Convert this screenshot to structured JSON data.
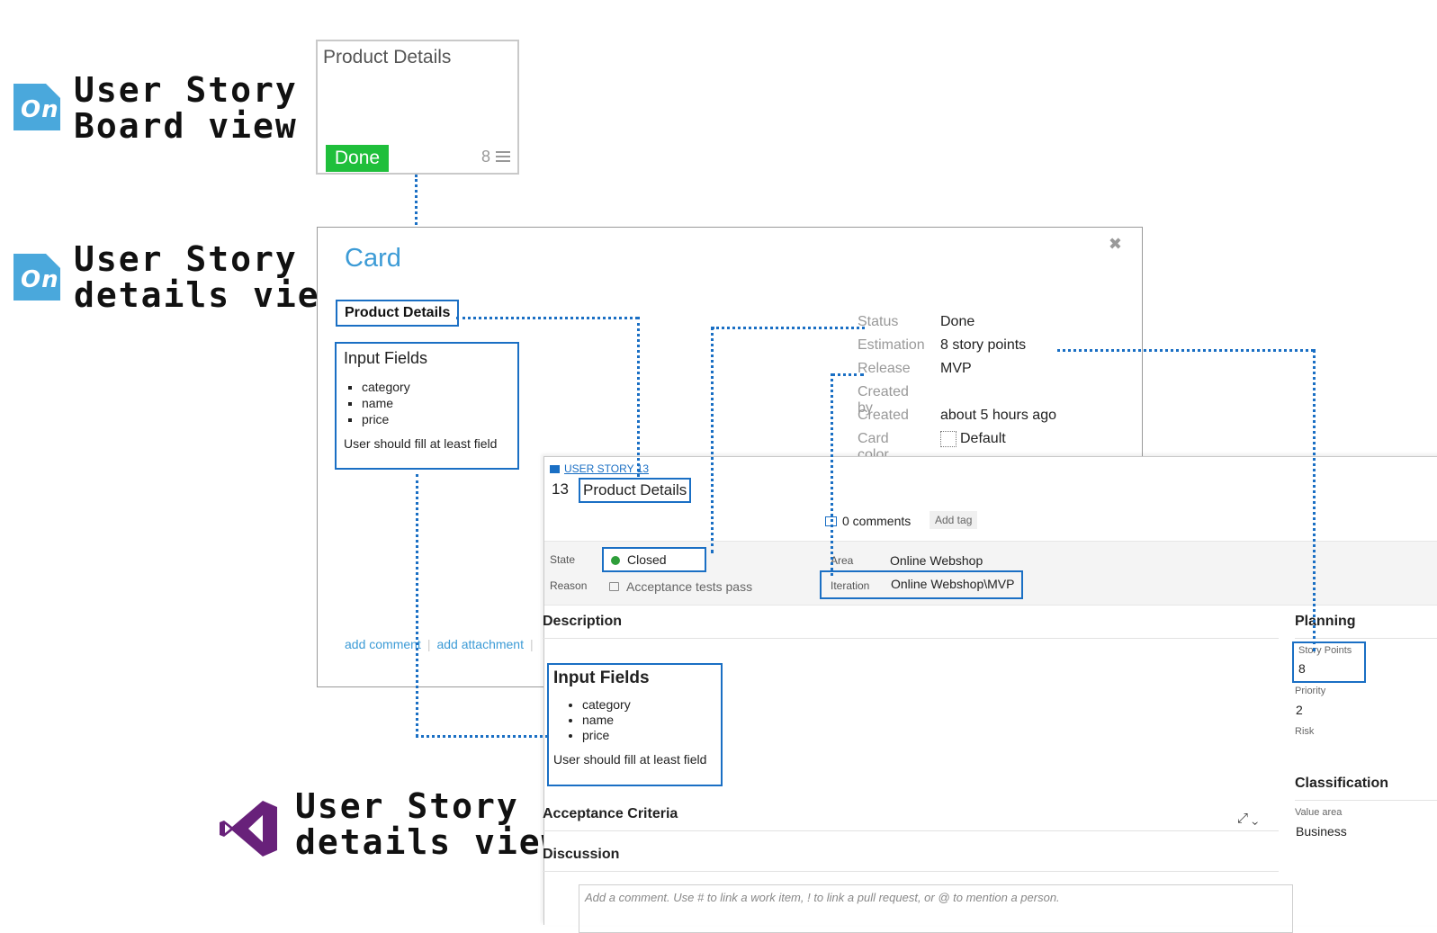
{
  "labels": {
    "board_view": [
      "User Story",
      "Board view"
    ],
    "tp_details_view": [
      "User Story",
      "details view"
    ],
    "vs_details_view": [
      "User Story",
      "details view"
    ],
    "on_logo_text": "On"
  },
  "board_card": {
    "title": "Product Details",
    "status": "Done",
    "points": "8"
  },
  "tp_card": {
    "heading": "Card",
    "name": "Product Details",
    "description": {
      "title": "Input Fields",
      "items": [
        "category",
        "name",
        "price"
      ],
      "footer": "User should fill at least field"
    },
    "properties": [
      {
        "key": "Status",
        "value": "Done"
      },
      {
        "key": "Estimation",
        "value": "8 story points"
      },
      {
        "key": "Release",
        "value": "MVP"
      },
      {
        "key": "Created by",
        "value": ""
      },
      {
        "key": "Created",
        "value": "about 5 hours ago"
      },
      {
        "key": "Card color",
        "value": "Default"
      }
    ],
    "links": {
      "add_comment": "add comment",
      "add_attachment": "add attachment"
    }
  },
  "work_item": {
    "type_link": "USER STORY 13",
    "id": "13",
    "title": "Product Details",
    "comments": "0 comments",
    "add_tag": "Add tag",
    "state_label": "State",
    "state_value": "Closed",
    "reason_label": "Reason",
    "reason_value": "Acceptance tests pass",
    "area_label": "Area",
    "area_value": "Online Webshop",
    "iteration_label": "Iteration",
    "iteration_value": "Online Webshop\\MVP",
    "description_header": "Description",
    "description": {
      "title": "Input Fields",
      "items": [
        "category",
        "name",
        "price"
      ],
      "footer": "User should fill at least field"
    },
    "acceptance_header": "Acceptance Criteria",
    "discussion_header": "Discussion",
    "comment_placeholder": "Add a comment. Use # to link a work item, ! to link a pull request, or @ to mention a person.",
    "planning_header": "Planning",
    "story_points_label": "Story Points",
    "story_points_value": "8",
    "priority_label": "Priority",
    "priority_value": "2",
    "risk_label": "Risk",
    "classification_header": "Classification",
    "value_area_label": "Value area",
    "value_area_value": "Business"
  },
  "colors": {
    "accent_blue": "#1a6fc4",
    "tp_blue": "#3c9bd6",
    "done_green": "#1fbf3b",
    "closed_green": "#2e9e3a",
    "vs_purple": "#68217a"
  }
}
